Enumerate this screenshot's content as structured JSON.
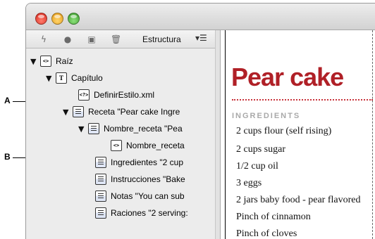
{
  "callouts": {
    "a": "A",
    "b": "B"
  },
  "toolbar": {
    "title": "Estructura",
    "menu_glyph": "▾☰"
  },
  "tree": [
    {
      "label": "Raíz",
      "icon": "element-tag-icon",
      "tri": "▼"
    },
    {
      "label": "Capítulo",
      "icon": "text-element-icon",
      "tri": "▼"
    },
    {
      "label": "DefinirEstilo.xml",
      "icon": "processing-instruction-icon",
      "tri": ""
    },
    {
      "label": "Receta  \"Pear cake Ingre",
      "icon": "element-icon",
      "tri": "▼"
    },
    {
      "label": "Nombre_receta  \"Pea",
      "icon": "element-icon",
      "tri": "▼"
    },
    {
      "label": "Nombre_receta",
      "icon": "element-tag-icon",
      "tri": ""
    },
    {
      "label": "Ingredientes   \"2 cup",
      "icon": "element-icon",
      "tri": ""
    },
    {
      "label": "Instrucciones   \"Bake",
      "icon": "element-icon",
      "tri": ""
    },
    {
      "label": "Notas  \"You can sub",
      "icon": "element-icon",
      "tri": ""
    },
    {
      "label": "Raciones  \"2 serving:",
      "icon": "element-icon",
      "tri": ""
    }
  ],
  "doc": {
    "title": "Pear cake",
    "section": "INGREDIENTS",
    "ingredients": [
      "2 cups flour (self rising)",
      "2 cups sugar",
      "1/2 cup oil",
      "3 eggs",
      "2 jars baby food - pear flavored",
      "Pinch of cinnamon",
      "Pinch of cloves"
    ]
  }
}
